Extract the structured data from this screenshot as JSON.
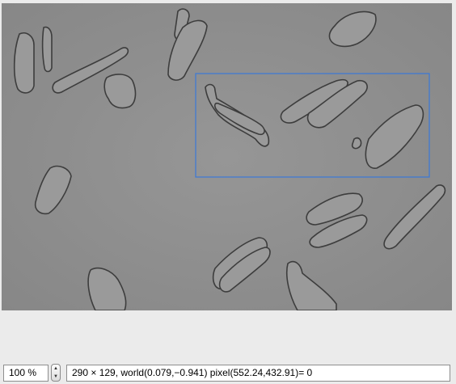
{
  "viewer": {
    "image_label": "microscopy-image",
    "selection_label": "roi-selection"
  },
  "statusbar": {
    "zoom_value": "100 %",
    "info_text": "290 × 129, world(0.079,−0.941) pixel(552.24,432.91)=  0"
  },
  "colors": {
    "image_background": "#8f8f8f",
    "selection_stroke": "#3a78d8"
  },
  "icons": {
    "stepper_up": "triangle-up",
    "stepper_down": "triangle-down"
  }
}
